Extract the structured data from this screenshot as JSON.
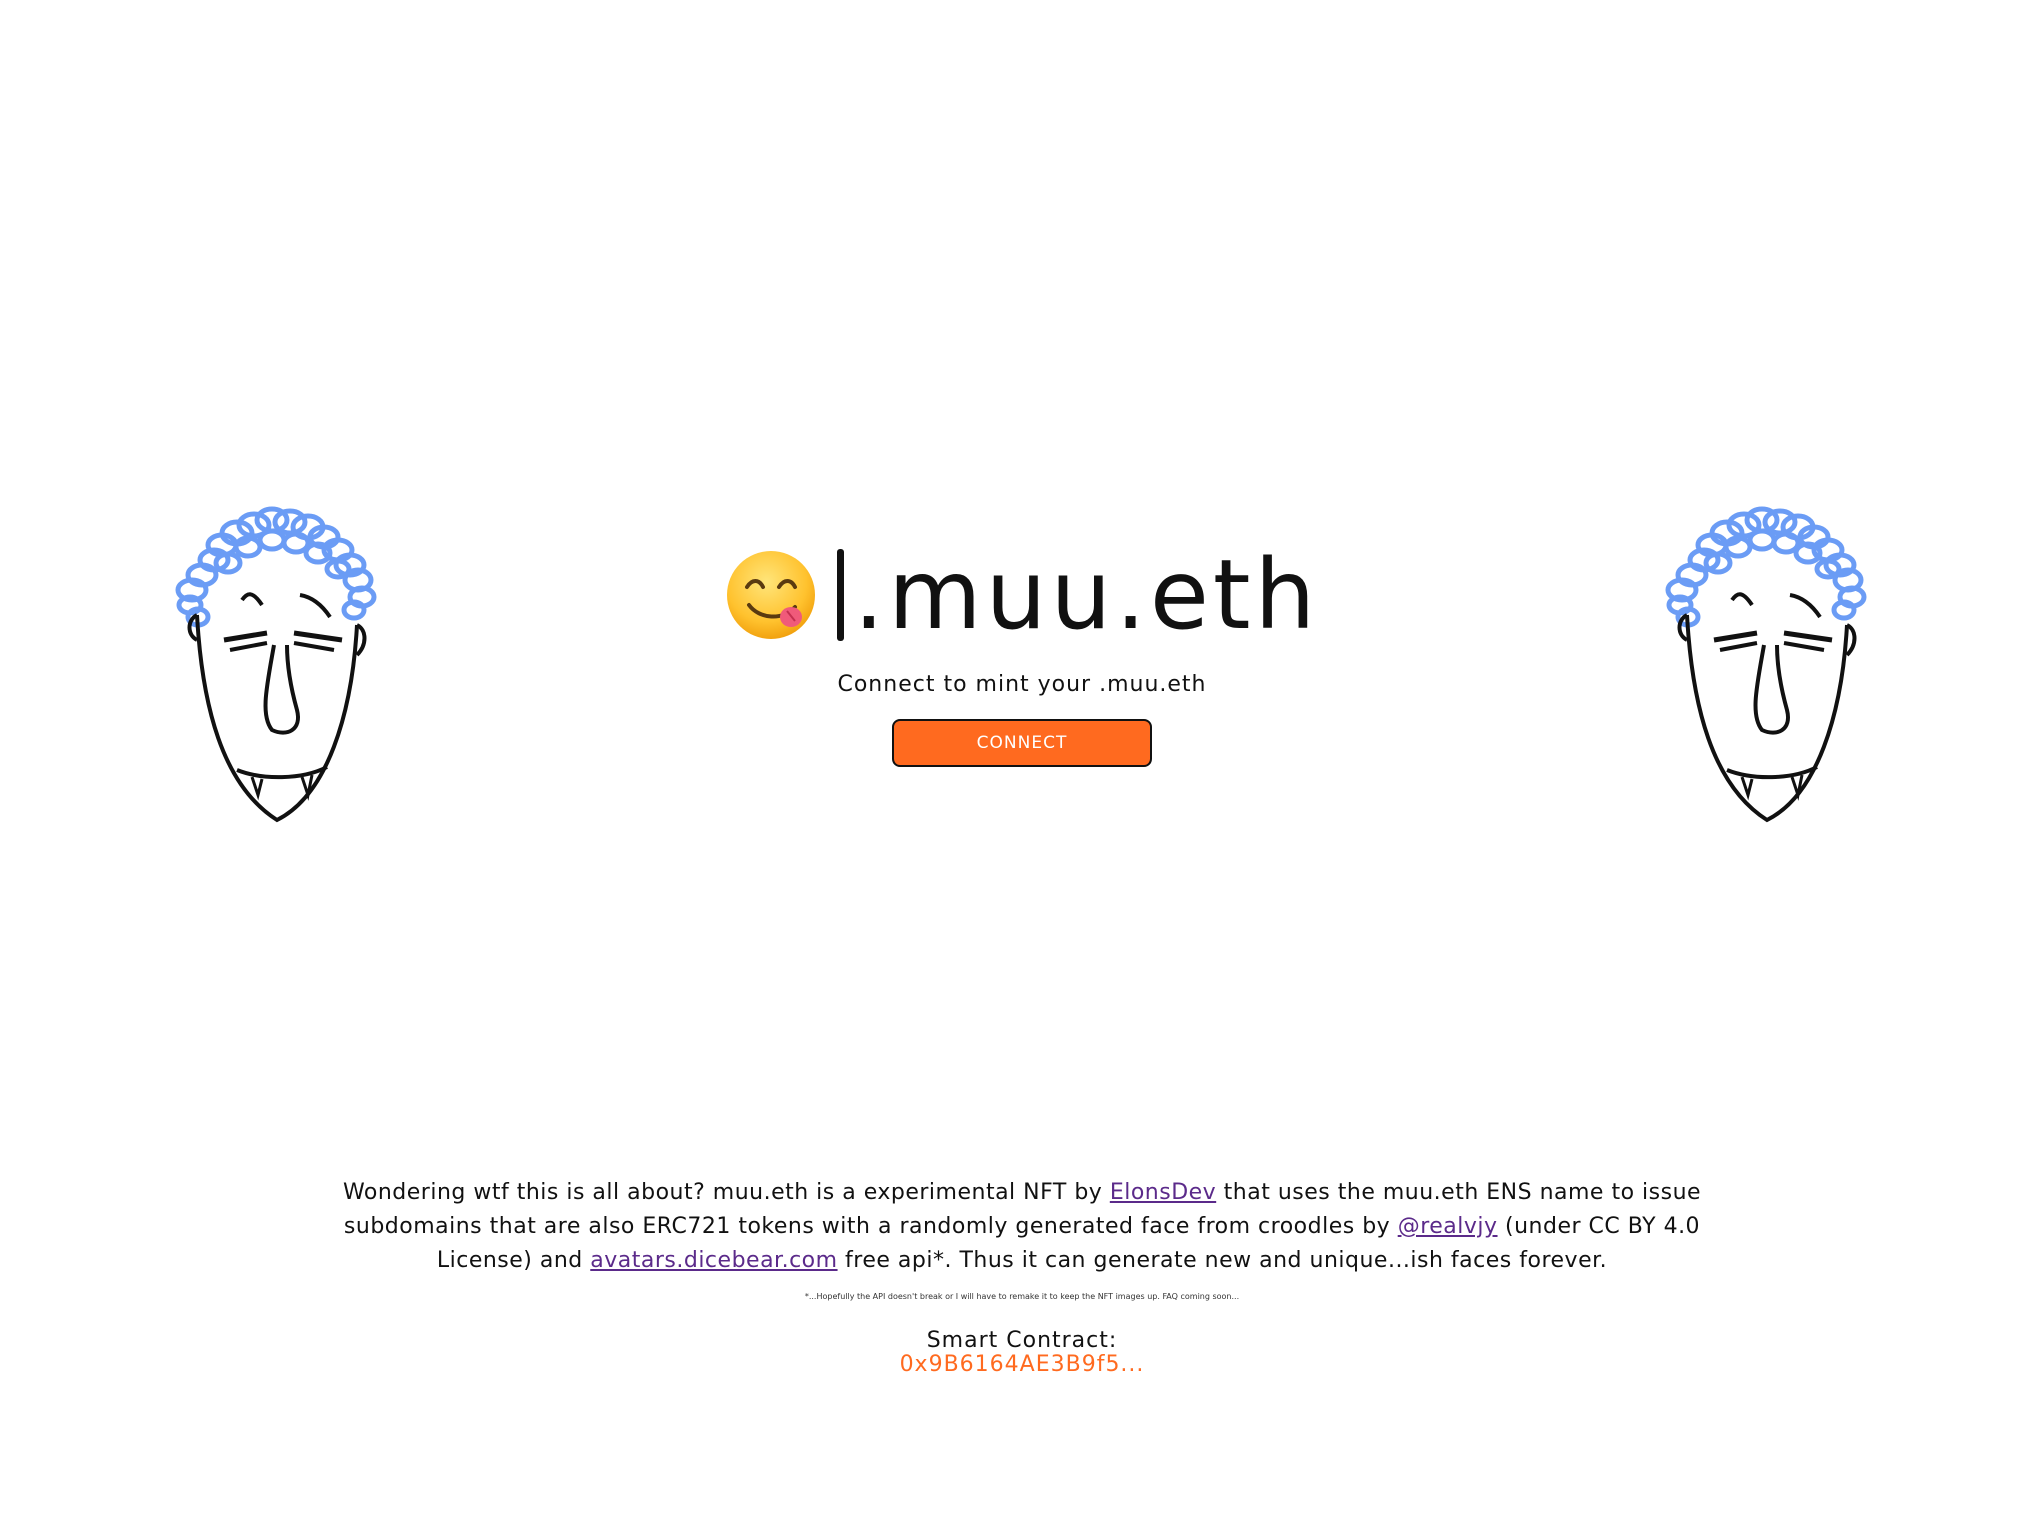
{
  "header": {
    "title_prefix": "",
    "title": ".muu.eth",
    "subtitle": "Connect to mint your .muu.eth",
    "connect_label": "CONNECT"
  },
  "about": {
    "part1": "Wondering wtf this is all about? muu.eth is a experimental NFT by ",
    "link_elonsdev": "ElonsDev",
    "part2": " that uses the muu.eth ENS name to issue subdomains that are also ERC721 tokens with a randomly generated face from croodles by ",
    "link_realvjy": "@realvjy",
    "part3": " (under CC BY 4.0 License) and ",
    "link_dicebear": "avatars.dicebear.com",
    "part4": " free api*. Thus it can generate new and unique...ish faces forever."
  },
  "footnote": "*...Hopefully the API doesn't break or I will have to remake it to keep the NFT images up. FAQ coming soon...",
  "contract": {
    "label": "Smart Contract:",
    "address": "0x9B6164AE3B9f5..."
  },
  "colors": {
    "accent": "#ff6a1f",
    "link": "#5b2a8a",
    "hair": "#6b9cf5"
  },
  "icons": {
    "emoji": "yum-face-emoji",
    "faces": "croodles-face-illustration"
  }
}
